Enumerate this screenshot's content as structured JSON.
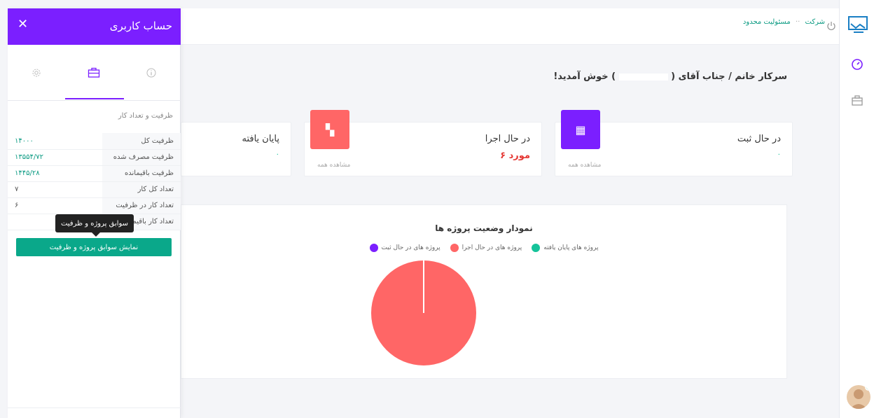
{
  "panel": {
    "title": "حساب کاربری",
    "close_icon": "close-icon",
    "tabs": [
      {
        "icon": "info-icon",
        "glyph": "ⓘ",
        "active": false
      },
      {
        "icon": "briefcase-icon",
        "glyph": "💼",
        "active": true
      },
      {
        "icon": "gear-icon",
        "glyph": "⚙",
        "active": false
      }
    ],
    "section_title": "ظرفیت و تعداد کار",
    "rows": [
      {
        "label": "ظرفیت کل",
        "value": "۱۴۰۰۰"
      },
      {
        "label": "ظرفیت مصرف شده",
        "value": "۱۳۵۵۴/۷۲"
      },
      {
        "label": "ظرفیت باقیمانده",
        "value": "۱۴۴۵/۲۸"
      },
      {
        "label": "تعداد کل کار",
        "value": "۷"
      },
      {
        "label": "تعداد کار در ظرفیت",
        "value": "۶"
      },
      {
        "label": "تعداد کار باقیمانده",
        "value": ""
      }
    ],
    "tooltip": "سوابق پروژه و ظرفیت",
    "history_button": "نمایش سوابق پروژه و ظرفیت"
  },
  "topbar": {
    "company_label": "شرکت",
    "company_type": "مسئولیت محدود",
    "power_icon": "power-icon"
  },
  "welcome": {
    "prefix": "سرکار خانم / جناب آقای (",
    "suffix": ") خوش آمدید!"
  },
  "cards": [
    {
      "title": "در حال ثبت",
      "value": "۰",
      "link": "مشاهده همه",
      "icon": "building-icon",
      "color": "#7b1fff"
    },
    {
      "title": "در حال اجرا",
      "value": "۶ مورد",
      "link": "مشاهده همه",
      "icon": "dashboard-icon",
      "color": "#ff6666"
    },
    {
      "title": "پایان یافته",
      "value": "۰",
      "link": "",
      "icon": "",
      "color": "#15c39a"
    }
  ],
  "chart_data": {
    "type": "pie",
    "title": "نمودار وضعیت پروژه ها",
    "categories": [
      "پروژه های پایان یافته",
      "پروژه های در حال اجرا",
      "پروژه های در حال ثبت"
    ],
    "values": [
      0,
      6,
      0
    ],
    "colors": [
      "#15c39a",
      "#ff6666",
      "#7b1fff"
    ]
  },
  "rail": {
    "logo_icon": "handshake-logo-icon",
    "items": [
      "speedometer-icon",
      "briefcase-icon"
    ],
    "avatar": "avatar"
  }
}
